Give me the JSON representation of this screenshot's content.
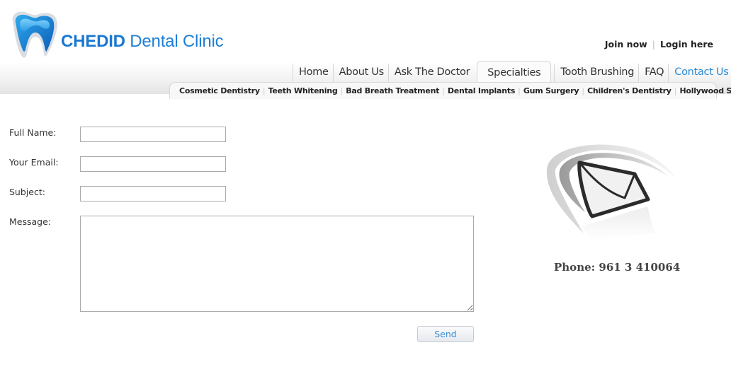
{
  "brand": {
    "name_bold": "CHEDID",
    "name_rest": " Dental Clinic",
    "logo_icon": "tooth-icon",
    "primary_color": "#1e7fd6"
  },
  "account": {
    "join_label": "Join now",
    "login_label": "Login here"
  },
  "main_nav": {
    "items": [
      {
        "label": "Home"
      },
      {
        "label": "About Us"
      },
      {
        "label": "Ask The Doctor"
      },
      {
        "label": "Specialties",
        "state": "open-tab"
      },
      {
        "label": "Tooth Brushing"
      },
      {
        "label": "FAQ"
      },
      {
        "label": "Contact Us",
        "state": "current"
      }
    ],
    "current_color": "#2a8ad4"
  },
  "sub_nav": {
    "items": [
      {
        "label": "Cosmetic Dentistry"
      },
      {
        "label": "Teeth Whitening"
      },
      {
        "label": "Bad Breath Treatment"
      },
      {
        "label": "Dental Implants"
      },
      {
        "label": "Gum Surgery"
      },
      {
        "label": "Children's Dentistry"
      },
      {
        "label": "Hollywood Smile"
      }
    ]
  },
  "contact_form": {
    "full_name": {
      "label": "Full Name:",
      "value": ""
    },
    "email": {
      "label": "Your Email:",
      "value": ""
    },
    "subject": {
      "label": "Subject:",
      "value": ""
    },
    "message": {
      "label": "Message:",
      "value": ""
    },
    "send_label": "Send"
  },
  "contact_info": {
    "mail_icon": "envelope-icon",
    "phone": "Phone: 961 3 410064"
  }
}
